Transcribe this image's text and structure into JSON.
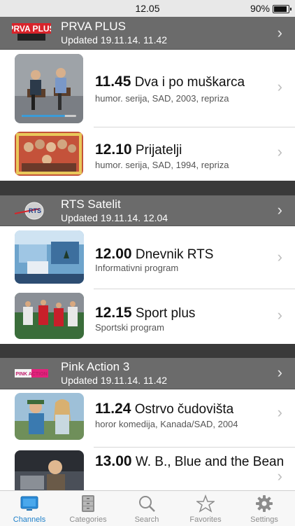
{
  "status_bar": {
    "time": "12.05",
    "battery": "90%",
    "battery_level": 0.9
  },
  "channels": [
    {
      "name": "PRVA PLUS",
      "updated": "Updated 19.11.14. 11.42",
      "logo": "prva-plus-logo",
      "logo_text": "PRVA PLUS",
      "programs": [
        {
          "time": "11.45",
          "title": "Dva i po muškarca",
          "subtitle": "humor. serija, SAD, 2003, repriza",
          "progress": 0.8
        },
        {
          "time": "12.10",
          "title": "Prijatelji",
          "subtitle": "humor. serija, SAD, 1994, repriza"
        }
      ]
    },
    {
      "name": "RTS Satelit",
      "updated": "Updated 19.11.14. 12.04",
      "logo": "rts-logo",
      "logo_text": "RTS",
      "programs": [
        {
          "time": "12.00",
          "title": "Dnevnik RTS",
          "subtitle": "Informativni program"
        },
        {
          "time": "12.15",
          "title": "Sport plus",
          "subtitle": "Sportski program"
        }
      ]
    },
    {
      "name": "Pink Action 3",
      "updated": "Updated 19.11.14. 11.42",
      "logo": "pink-action-logo",
      "logo_text": "PINK ACTION",
      "programs": [
        {
          "time": "11.24",
          "title": "Ostrvo čudovišta",
          "subtitle": "horor komedija, Kanada/SAD, 2004"
        },
        {
          "time": "13.00",
          "title": "W. B., Blue and the Bean",
          "subtitle": ""
        }
      ]
    }
  ],
  "tabs": [
    {
      "label": "Channels",
      "icon": "tv-icon",
      "active": true
    },
    {
      "label": "Categories",
      "icon": "cabinet-icon"
    },
    {
      "label": "Search",
      "icon": "search-icon"
    },
    {
      "label": "Favorites",
      "icon": "star-icon"
    },
    {
      "label": "Settings",
      "icon": "gear-icon"
    }
  ],
  "colors": {
    "accent": "#1d7fc9",
    "header_bg": "#6b6b6b",
    "separator": "#3a3a3a",
    "progress": "#3b9bd8"
  }
}
